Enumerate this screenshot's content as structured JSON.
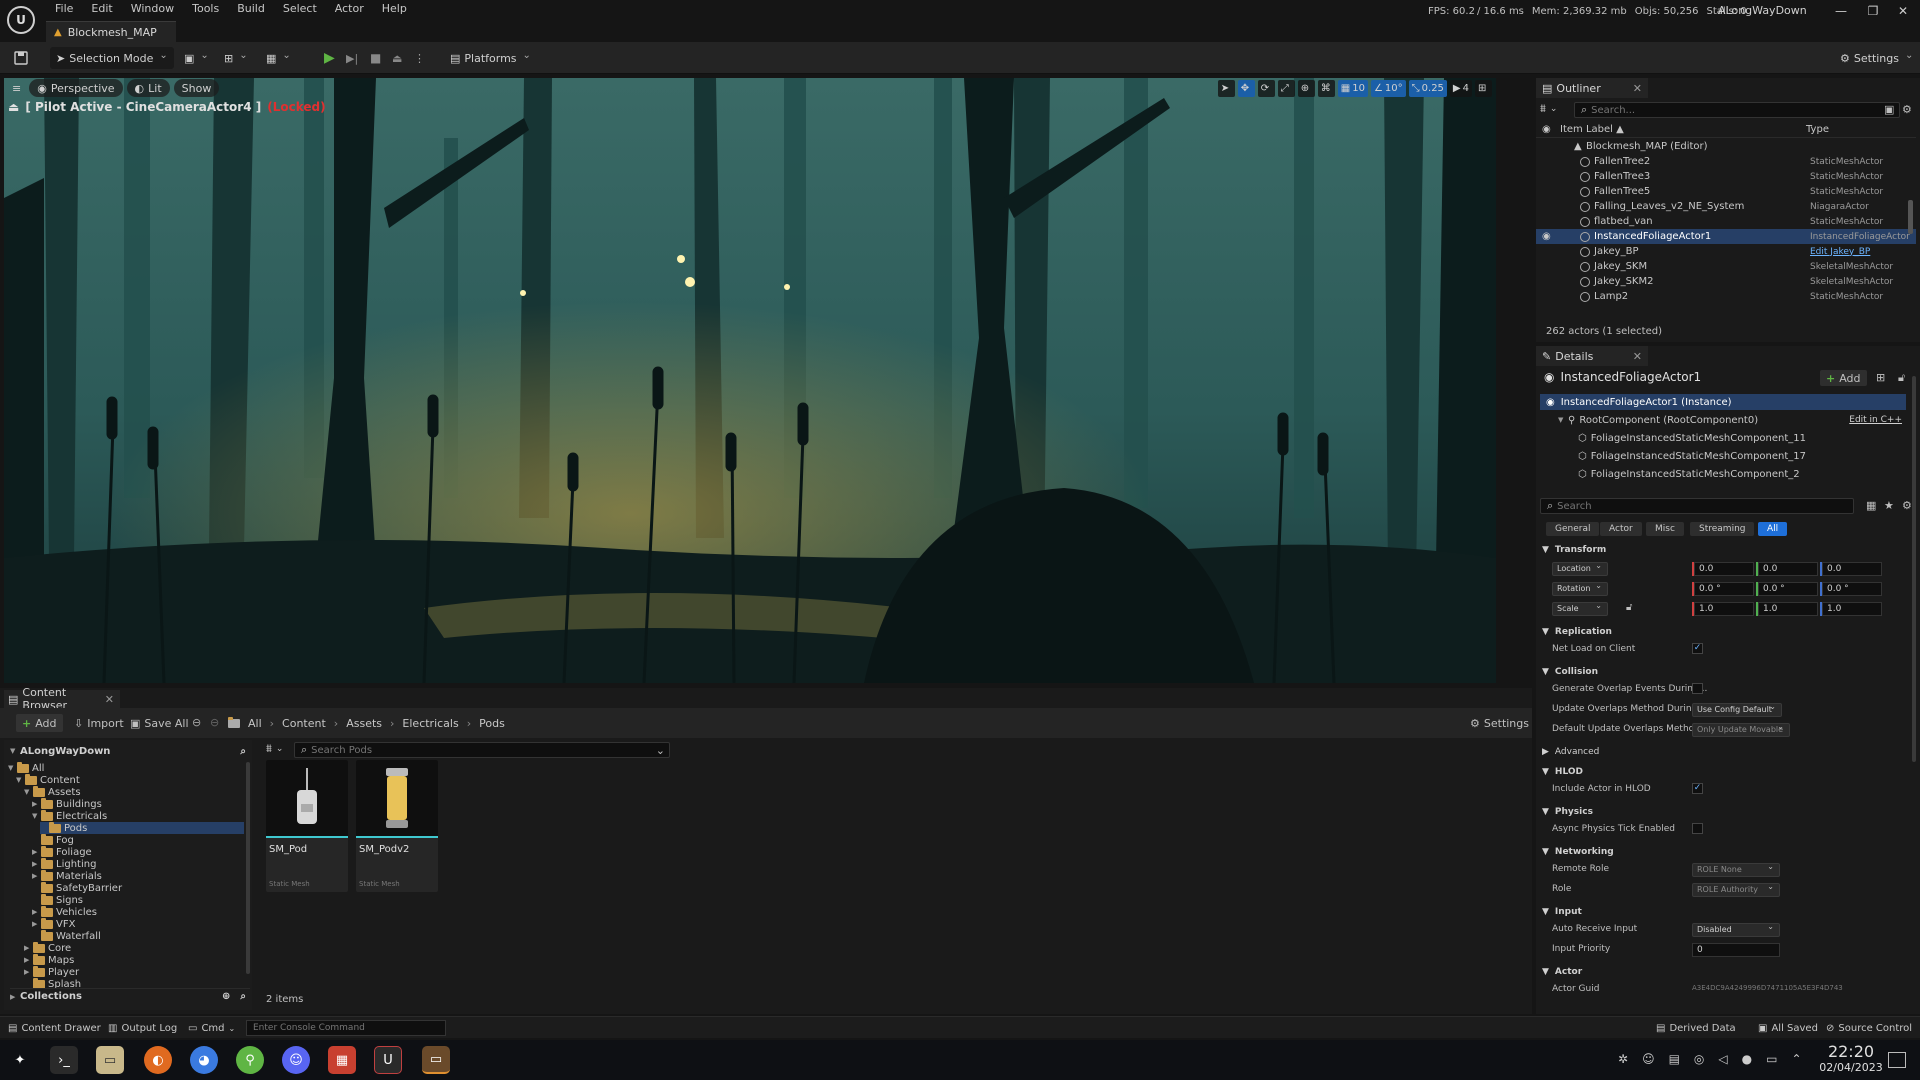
{
  "app": {
    "menu": [
      "File",
      "Edit",
      "Window",
      "Tools",
      "Build",
      "Select",
      "Actor",
      "Help"
    ],
    "document_tab": "Blockmesh_MAP",
    "stats": {
      "fps": "FPS: 60.2",
      "ms": "/ 16.6 ms",
      "mem": "Mem: 2,369.32 mb",
      "objs": "Objs: 50,256",
      "stalls": "Stalls: 0"
    },
    "project_name": "ALongWayDown"
  },
  "toolbar": {
    "selection_mode": "Selection Mode",
    "platforms": "Platforms",
    "settings": "Settings"
  },
  "viewport": {
    "perspective": "Perspective",
    "lit": "Lit",
    "show": "Show",
    "pilot_label": "[ Pilot Active - CineCameraActor4 ]",
    "locked": "(Locked)",
    "grid_snap": "10",
    "rot_snap": "10°",
    "scale_snap": "0.25",
    "camera_speed": "4"
  },
  "content_browser": {
    "tab": "Content Browser",
    "add": "Add",
    "import": "Import",
    "save_all": "Save All",
    "breadcrumb": [
      "All",
      "Content",
      "Assets",
      "Electricals",
      "Pods"
    ],
    "settings": "Settings",
    "project_root": "ALongWayDown",
    "search_placeholder": "Search Pods",
    "tree": [
      {
        "label": "All",
        "depth": 0
      },
      {
        "label": "Content",
        "depth": 1
      },
      {
        "label": "Assets",
        "depth": 2
      },
      {
        "label": "Buildings",
        "depth": 3
      },
      {
        "label": "Electricals",
        "depth": 3
      },
      {
        "label": "Pods",
        "depth": 4
      },
      {
        "label": "Fog",
        "depth": 3
      },
      {
        "label": "Foliage",
        "depth": 3
      },
      {
        "label": "Lighting",
        "depth": 3
      },
      {
        "label": "Materials",
        "depth": 3
      },
      {
        "label": "SafetyBarrier",
        "depth": 3
      },
      {
        "label": "Signs",
        "depth": 3
      },
      {
        "label": "Vehicles",
        "depth": 3
      },
      {
        "label": "VFX",
        "depth": 3
      },
      {
        "label": "Waterfall",
        "depth": 3
      },
      {
        "label": "Core",
        "depth": 2
      },
      {
        "label": "Maps",
        "depth": 2
      },
      {
        "label": "Player",
        "depth": 2
      },
      {
        "label": "Splash",
        "depth": 2
      }
    ],
    "collections": "Collections",
    "assets": [
      {
        "name": "SM_Pod",
        "type": "Static Mesh"
      },
      {
        "name": "SM_Podv2",
        "type": "Static Mesh"
      }
    ],
    "item_count": "2 items"
  },
  "statusbar": {
    "content_drawer": "Content Drawer",
    "output_log": "Output Log",
    "cmd": "Cmd",
    "console_placeholder": "Enter Console Command",
    "derived_data": "Derived Data",
    "all_saved": "All Saved",
    "source_control": "Source Control"
  },
  "outliner": {
    "tab": "Outliner",
    "search_placeholder": "Search...",
    "col_label": "Item Label ▲",
    "col_type": "Type",
    "root": "Blockmesh_MAP (Editor)",
    "rows": [
      {
        "name": "FallenTree2",
        "type": "StaticMeshActor"
      },
      {
        "name": "FallenTree3",
        "type": "StaticMeshActor"
      },
      {
        "name": "FallenTree5",
        "type": "StaticMeshActor"
      },
      {
        "name": "Falling_Leaves_v2_NE_System",
        "type": "NiagaraActor"
      },
      {
        "name": "flatbed_van",
        "type": "StaticMeshActor"
      },
      {
        "name": "InstancedFoliageActor1",
        "type": "InstancedFoliageActor"
      },
      {
        "name": "Jakey_BP",
        "type": "Edit Jakey_BP"
      },
      {
        "name": "Jakey_SKM",
        "type": "SkeletalMeshActor"
      },
      {
        "name": "Jakey_SKM2",
        "type": "SkeletalMeshActor"
      },
      {
        "name": "Lamp2",
        "type": "StaticMeshActor"
      }
    ],
    "footer": "262 actors (1 selected)"
  },
  "details": {
    "tab": "Details",
    "actor_name": "InstancedFoliageActor1",
    "add": "Add",
    "components": [
      "InstancedFoliageActor1 (Instance)",
      "RootComponent (RootComponent0)",
      "FoliageInstancedStaticMeshComponent_11",
      "FoliageInstancedStaticMeshComponent_17",
      "FoliageInstancedStaticMeshComponent_2"
    ],
    "edit_cpp": "Edit in C++",
    "search_placeholder": "Search",
    "filters": [
      "General",
      "Actor",
      "Misc",
      "Streaming",
      "All"
    ],
    "sections": {
      "transform": "Transform",
      "replication": "Replication",
      "collision": "Collision",
      "advanced": "Advanced",
      "hlod": "HLOD",
      "physics": "Physics",
      "networking": "Networking",
      "input": "Input",
      "actor": "Actor"
    },
    "location_label": "Location",
    "rotation_label": "Rotation",
    "scale_label": "Scale",
    "location": [
      "0.0",
      "0.0",
      "0.0"
    ],
    "rotation": [
      "0.0 °",
      "0.0 °",
      "0.0 °"
    ],
    "scale": [
      "1.0",
      "1.0",
      "1.0"
    ],
    "net_load": "Net Load on Client",
    "gen_overlap": "Generate Overlap Events During...",
    "update_overlap": "Update Overlaps Method During...",
    "update_overlap_val": "Use Config Default",
    "default_update_overlap": "Default Update Overlaps Method...",
    "default_update_overlap_val": "Only Update Movable",
    "include_hlod": "Include Actor in HLOD",
    "async_physics": "Async Physics Tick Enabled",
    "remote_role": "Remote Role",
    "remote_role_val": "ROLE None",
    "role": "Role",
    "role_val": "ROLE Authority",
    "auto_receive": "Auto Receive Input",
    "auto_receive_val": "Disabled",
    "input_priority": "Input Priority",
    "input_priority_val": "0",
    "actor_guid": "Actor Guid",
    "actor_guid_val": "A3E4DC9A4249996D7471105A5E3F4D743"
  },
  "taskbar": {
    "time": "22:20",
    "date": "02/04/2023"
  },
  "colors": {
    "accent": "#1e6fd9",
    "selection": "#263f66",
    "locked": "#e03030",
    "play": "#5fb544"
  }
}
